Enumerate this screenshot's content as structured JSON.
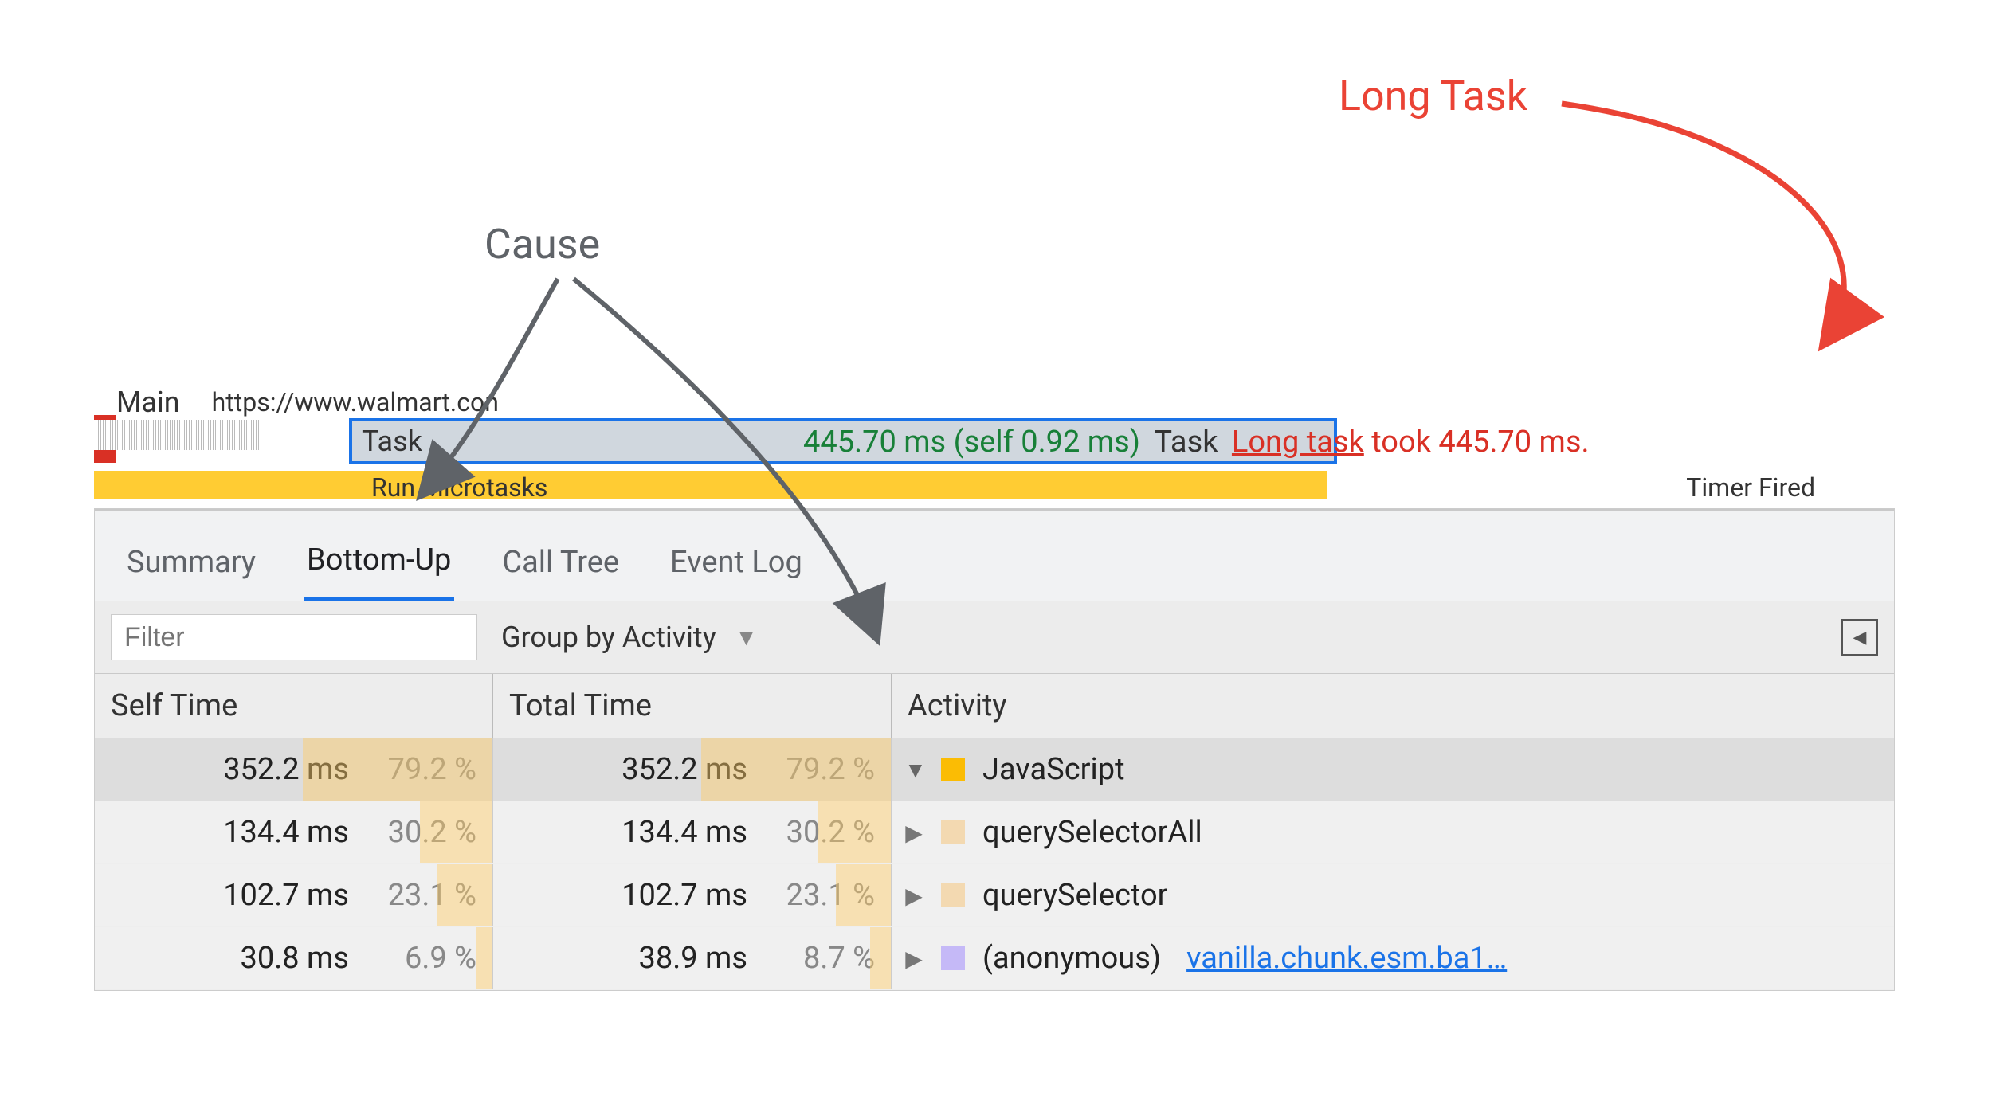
{
  "annotations": {
    "long_task_label": "Long Task",
    "cause_label": "Cause"
  },
  "timeline": {
    "main_label": "Main",
    "url_fragment": "https://www.walmart.con",
    "task_label": "Task",
    "duration_text": "445.70 ms (self 0.92 ms)",
    "task_text": "Task",
    "long_task_link": "Long task",
    "long_task_rest": " took 445.70 ms.",
    "microtasks": "Run Microtasks",
    "timer_fired": "Timer Fired"
  },
  "tabs": {
    "summary": "Summary",
    "bottomup": "Bottom-Up",
    "calltree": "Call Tree",
    "eventlog": "Event Log",
    "active": "bottomup"
  },
  "toolbar": {
    "filter_placeholder": "Filter",
    "group_by_label": "Group by Activity"
  },
  "columns": {
    "self": "Self Time",
    "total": "Total Time",
    "activity": "Activity"
  },
  "rows": [
    {
      "self_ms": "352.2 ms",
      "self_pct": "79.2 %",
      "self_barw": 79.2,
      "tot_ms": "352.2 ms",
      "tot_pct": "79.2 %",
      "tot_barw": 79.2,
      "tri": "down",
      "swatch": "js",
      "activity": "JavaScript",
      "link": "",
      "selected": true
    },
    {
      "self_ms": "134.4 ms",
      "self_pct": "30.2 %",
      "self_barw": 30.2,
      "tot_ms": "134.4 ms",
      "tot_pct": "30.2 %",
      "tot_barw": 30.2,
      "tri": "right",
      "swatch": "qsa",
      "activity": "querySelectorAll",
      "link": "",
      "selected": false
    },
    {
      "self_ms": "102.7 ms",
      "self_pct": "23.1 %",
      "self_barw": 23.1,
      "tot_ms": "102.7 ms",
      "tot_pct": "23.1 %",
      "tot_barw": 23.1,
      "tri": "right",
      "swatch": "qsa",
      "activity": "querySelector",
      "link": "",
      "selected": false
    },
    {
      "self_ms": "30.8 ms",
      "self_pct": "6.9 %",
      "self_barw": 6.9,
      "tot_ms": "38.9 ms",
      "tot_pct": "8.7 %",
      "tot_barw": 8.7,
      "tri": "right",
      "swatch": "anon",
      "activity": "(anonymous)",
      "link": "vanilla.chunk.esm.ba1…",
      "selected": false
    }
  ]
}
